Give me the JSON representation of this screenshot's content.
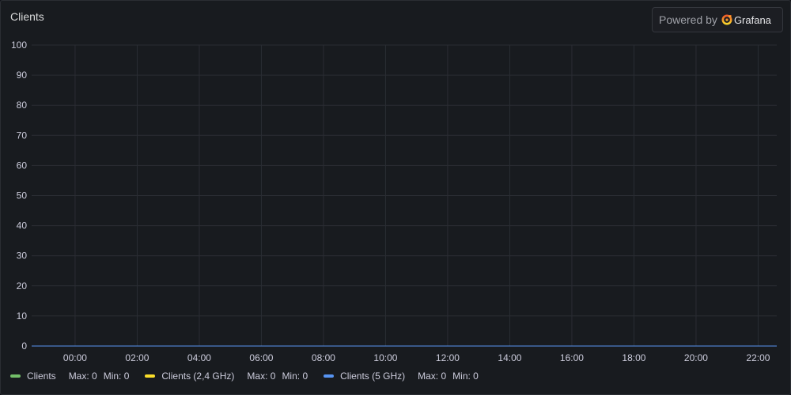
{
  "panel": {
    "title": "Clients",
    "powered_by": "Powered by",
    "brand": "Grafana"
  },
  "chart_data": {
    "type": "line",
    "title": "Clients",
    "ylim": [
      0,
      100
    ],
    "y_ticks": [
      0,
      10,
      20,
      30,
      40,
      50,
      60,
      70,
      80,
      90,
      100
    ],
    "x_ticks": [
      "00:00",
      "02:00",
      "04:00",
      "06:00",
      "08:00",
      "10:00",
      "12:00",
      "14:00",
      "16:00",
      "18:00",
      "20:00",
      "22:00"
    ],
    "xlim_hours": [
      -1.4,
      22.6
    ],
    "grid": true,
    "legend_position": "bottom",
    "series": [
      {
        "name": "Clients",
        "color": "#73bf69",
        "max": "Max: 0",
        "min": "Min: 0",
        "x": [
          -1.4,
          22.6
        ],
        "y": [
          0,
          0
        ]
      },
      {
        "name": "Clients (2,4 GHz)",
        "color": "#fade2a",
        "max": "Max: 0",
        "min": "Min: 0",
        "x": [
          -1.4,
          22.6
        ],
        "y": [
          0,
          0
        ]
      },
      {
        "name": "Clients (5 GHz)",
        "color": "#5794f2",
        "max": "Max: 0",
        "min": "Min: 0",
        "x": [
          -1.4,
          22.6
        ],
        "y": [
          0,
          0
        ]
      }
    ]
  }
}
